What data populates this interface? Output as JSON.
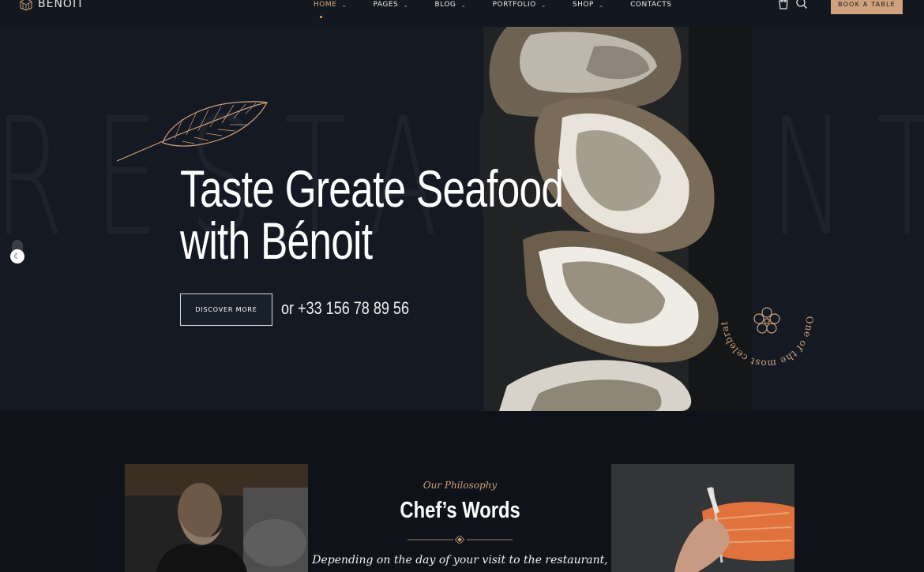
{
  "header": {
    "logo_text": "BENOIT",
    "nav": [
      {
        "label": "HOME",
        "active": true,
        "dropdown": true
      },
      {
        "label": "PAGES",
        "active": false,
        "dropdown": true
      },
      {
        "label": "BLOG",
        "active": false,
        "dropdown": true
      },
      {
        "label": "PORTFOLIO",
        "active": false,
        "dropdown": true
      },
      {
        "label": "SHOP",
        "active": false,
        "dropdown": true
      },
      {
        "label": "CONTACTS",
        "active": false,
        "dropdown": false
      }
    ],
    "icons": [
      "bag-icon",
      "search-icon"
    ],
    "cta_label": "BOOK A TABLE"
  },
  "hero": {
    "background_word": "RESTAURANT",
    "title_line1": "Taste Greate Seafood",
    "title_line2": "with Bénoit",
    "cta_label": "DISCOVER MORE",
    "phone": "or +33 156 78 89 56",
    "badge_text": "One of the most celebrated restaurants in country"
  },
  "philosophy": {
    "subtitle": "Our Philosophy",
    "title": "Chef’s Words",
    "quote": "Depending on the day of your visit to the restaurant,"
  },
  "colors": {
    "accent": "#cfa17c",
    "hero_bg": "#141923",
    "page_bg": "#0f1319"
  }
}
